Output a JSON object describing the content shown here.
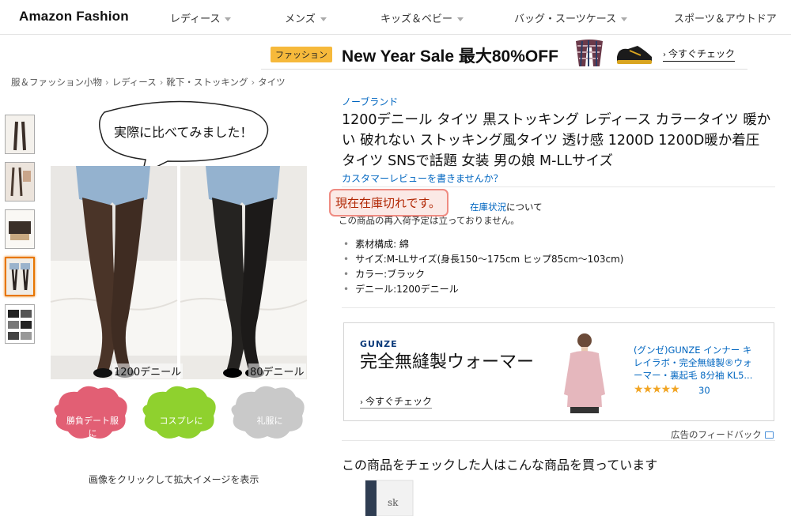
{
  "nav": {
    "logo": "Amazon Fashion",
    "items": [
      "レディース",
      "メンズ",
      "キッズ＆ベビー",
      "バッグ・スーツケース",
      "スポーツ＆アウトドア"
    ]
  },
  "banner": {
    "tag": "ファッション",
    "sale_text": "New Year Sale 最大80%OFF",
    "cta": "今すぐチェック"
  },
  "breadcrumb": [
    "服＆ファッション小物",
    "レディース",
    "靴下・ストッキング",
    "タイツ"
  ],
  "gallery": {
    "speech_bubble": "実際に比べてみました！",
    "left_label": "1200デニール",
    "right_label": "80デニール",
    "cloud_labels": [
      "勝負デート服に",
      "コスプレに",
      "礼服に"
    ],
    "caption": "画像をクリックして拡大イメージを表示",
    "active_thumb": 4
  },
  "product": {
    "brand": "ノーブランド",
    "title": "1200デニール タイツ 黒ストッキング レディース カラータイツ 暖かい 破れない ストッキング風タイツ 透け感 1200D 1200D暖か着圧タイツ SNSで話題 女装 男の娘 M-LLサイズ",
    "review_link": "カスタマーレビューを書きませんか？",
    "stock": "現在在庫切れです。",
    "stock_link": "在庫状況",
    "stock_note_rest": "について",
    "stock_note2": "この商品の再入荷予定は立っておりません。",
    "bullets": [
      "素材構成: 綿",
      "サイズ:M-LLサイズ(身長150〜175cm ヒップ85cm〜103cm)",
      "カラー:ブラック",
      "デニール:1200デニール"
    ]
  },
  "ad": {
    "brand": "GUNZE",
    "headline": "完全無縫製ウォーマー",
    "cta": "今すぐチェック",
    "product_name": "(グンゼ)GUNZE インナー キレイラボ・完全無縫製®ウォーマー・裏起毛 8分袖 KL5...",
    "stars": "★★★★★",
    "rating_value": 4.5,
    "review_count": "30"
  },
  "feedback": "広告のフィードバック",
  "section_title": "この商品をチェックした人はこんな商品を買っています"
}
